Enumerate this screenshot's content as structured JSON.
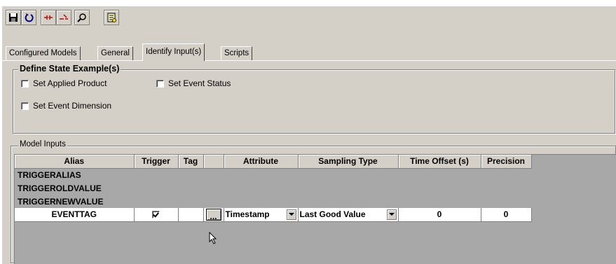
{
  "toolbar": {
    "buttons": [
      {
        "name": "save-icon"
      },
      {
        "name": "undo-icon"
      },
      {
        "name": "connect-icon"
      },
      {
        "name": "disconnect-icon"
      },
      {
        "name": "search-icon"
      },
      {
        "name": "properties-icon"
      }
    ]
  },
  "tabs": [
    {
      "label": "Configured Models",
      "active": false
    },
    {
      "label": "General",
      "active": false
    },
    {
      "label": "Identify Input(s)",
      "active": true
    },
    {
      "label": "Scripts",
      "active": false
    }
  ],
  "state_group": {
    "title": "Define State Example(s)",
    "checkboxes": {
      "applied_product": {
        "label": "Set Applied Product",
        "checked": false
      },
      "event_status": {
        "label": "Set Event Status",
        "checked": false
      },
      "event_dimension": {
        "label": "Set Event Dimension",
        "checked": false
      }
    }
  },
  "inputs_group": {
    "title": "Model Inputs",
    "columns": [
      "Alias",
      "Trigger",
      "Tag",
      "",
      "Attribute",
      "Sampling Type",
      "Time Offset (s)",
      "Precision"
    ],
    "alias_rows": [
      "TRIGGERALIAS",
      "TRIGGEROLDVALUE",
      "TRIGGERNEWVALUE"
    ],
    "event_row": {
      "alias": "EVENTTAG",
      "trigger_checked": true,
      "tag": "",
      "browse": "...",
      "attribute": "Timestamp",
      "sampling_type": "Last Good Value",
      "time_offset": "0",
      "precision": "0"
    }
  },
  "colors": {
    "face": "#d4d0c8",
    "grid_bg": "#a8a8a8"
  }
}
